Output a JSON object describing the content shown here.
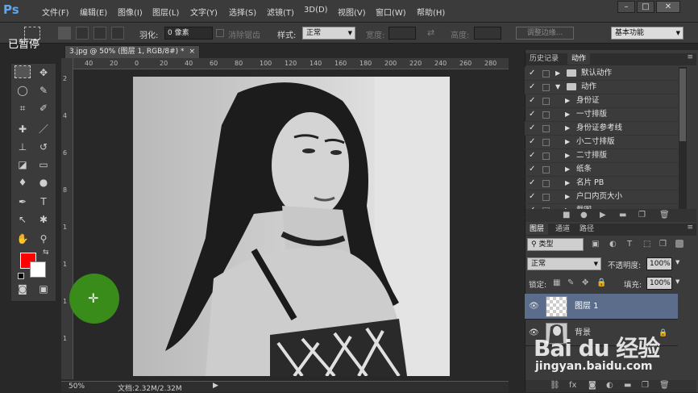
{
  "app": {
    "logo": "Ps"
  },
  "menu": [
    "文件(F)",
    "编辑(E)",
    "图像(I)",
    "图层(L)",
    "文字(Y)",
    "选择(S)",
    "滤镜(T)",
    "3D(D)",
    "视图(V)",
    "窗口(W)",
    "帮助(H)"
  ],
  "window_controls": [
    "–",
    "□",
    "✕"
  ],
  "options": {
    "feather_label": "羽化:",
    "feather_value": "0 像素",
    "antialias_label": "消除锯齿",
    "style_label": "样式:",
    "style_value": "正常",
    "width_label": "宽度:",
    "height_label": "高度:",
    "refine_edge": "调整边缘...",
    "workspace": "基本功能"
  },
  "overlay": {
    "paused": "已暂停"
  },
  "document": {
    "tab": "3.jpg @ 50% (图层 1, RGB/8#) *",
    "ruler_top": [
      "40",
      "20",
      "0",
      "20",
      "40",
      "60",
      "80",
      "100",
      "120",
      "140",
      "160",
      "180",
      "200",
      "220",
      "240",
      "260",
      "280"
    ],
    "ruler_left": [
      "2",
      "4",
      "6",
      "8",
      "1",
      "1",
      "1",
      "1"
    ],
    "zoom": "50%",
    "doc_size": "文档:2.32M/2.32M"
  },
  "actions_panel": {
    "tabs": [
      "历史记录",
      "动作"
    ],
    "rows": [
      {
        "label": "默认动作",
        "check": "✓"
      },
      {
        "label": "动作",
        "check": "✓"
      },
      {
        "label": "身份证",
        "check": "✓"
      },
      {
        "label": "一寸排版",
        "check": "✓"
      },
      {
        "label": "身份证参考线",
        "check": "✓"
      },
      {
        "label": "小二寸排版",
        "check": "✓"
      },
      {
        "label": "二寸排版",
        "check": "✓"
      },
      {
        "label": "纸条",
        "check": "✓"
      },
      {
        "label": "名片 PB",
        "check": "✓"
      },
      {
        "label": "户口内页大小",
        "check": "✓"
      },
      {
        "label": "截图",
        "check": "✓"
      }
    ]
  },
  "layers_panel": {
    "tabs": [
      "图层",
      "通道",
      "路径"
    ],
    "filter": "类型",
    "blend_mode": "正常",
    "opacity_label": "不透明度:",
    "opacity_value": "100%",
    "lock_label": "锁定:",
    "fill_label": "填充:",
    "fill_value": "100%",
    "layers": [
      {
        "name": "图层 1"
      },
      {
        "name": "背景"
      }
    ]
  },
  "watermark": {
    "brand": "Bai du 经验",
    "url": "jingyan.baidu.com"
  }
}
